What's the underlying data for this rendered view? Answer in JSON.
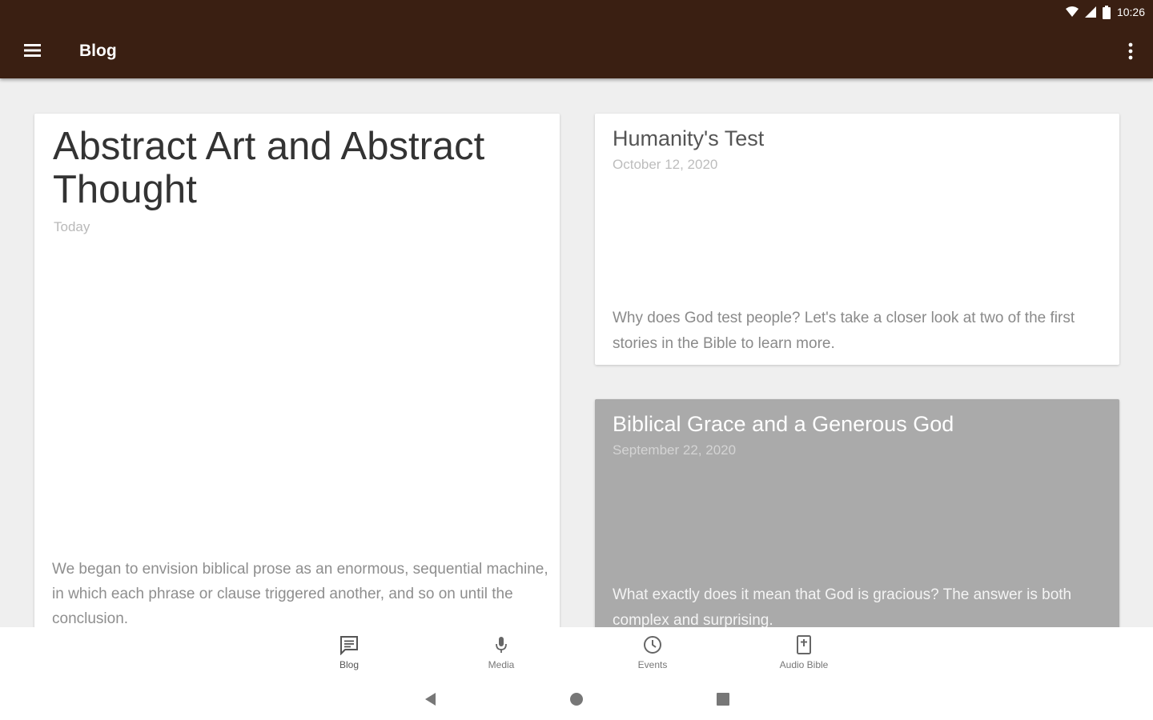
{
  "status_bar": {
    "time": "10:26"
  },
  "app_bar": {
    "title": "Blog"
  },
  "posts": [
    {
      "title": "Abstract Art and Abstract Thought",
      "date": "Today",
      "excerpt": "We began to envision biblical prose as an enormous, sequential machine, in which each phrase or clause triggered another, and so on until the conclusion."
    },
    {
      "title": "Humanity's Test",
      "date": "October 12, 2020",
      "excerpt": "Why does God test people? Let's take a closer look at two of the first stories in the Bible to learn more."
    },
    {
      "title": "Biblical Grace and a Generous God",
      "date": "September 22, 2020",
      "excerpt": "What exactly does it mean that God is gracious? The answer is both complex and surprising."
    }
  ],
  "bottom_nav": [
    {
      "label": "Blog",
      "icon": "blog-icon"
    },
    {
      "label": "Media",
      "icon": "microphone-icon"
    },
    {
      "label": "Events",
      "icon": "clock-icon"
    },
    {
      "label": "Audio Bible",
      "icon": "bible-icon"
    }
  ],
  "colors": {
    "app_bar": "#3a1f12",
    "background": "#efefef",
    "grace_card": "#aaaaaa"
  }
}
